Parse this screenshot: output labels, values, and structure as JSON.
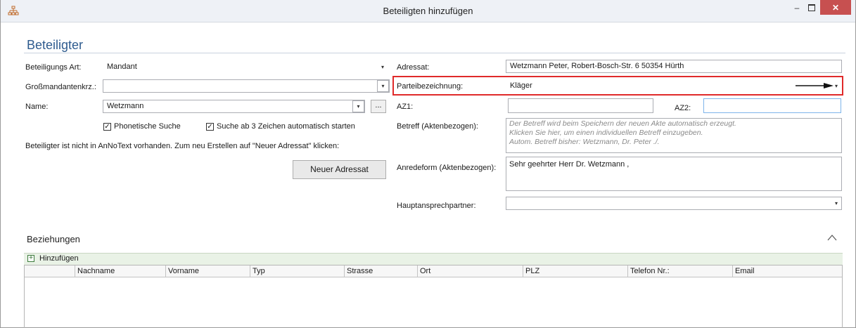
{
  "window": {
    "title": "Beteiligten hinzufügen",
    "app_icon": "network-icon",
    "minimize_glyph": "–",
    "close_glyph": "✕"
  },
  "section": {
    "heading": "Beteiligter"
  },
  "left": {
    "beteiligungs_art": {
      "label": "Beteiligungs Art:",
      "value": "Mandant"
    },
    "grossmandant": {
      "label": "Großmandantenkrz.:",
      "value": ""
    },
    "name": {
      "label": "Name:",
      "value": "Wetzmann",
      "button": "..."
    },
    "phonetisch": {
      "label": "Phonetische Suche",
      "checked": true
    },
    "auto_suche": {
      "label": "Suche ab 3 Zeichen automatisch starten",
      "checked": true
    },
    "info": "Beteiligter ist nicht in AnNoText vorhanden. Zum neu Erstellen auf \"Neuer Adressat\" klicken:",
    "neuer_adressat": "Neuer Adressat"
  },
  "right": {
    "adressat": {
      "label": "Adressat:",
      "value": "Wetzmann Peter, Robert-Bosch-Str. 6 50354 Hürth"
    },
    "parteibezeichnung": {
      "label": "Parteibezeichnung:",
      "value": "Kläger"
    },
    "az1": {
      "label": "AZ1:",
      "value": ""
    },
    "az2": {
      "label": "AZ2:",
      "value": ""
    },
    "betreff": {
      "label": "Betreff (Aktenbezogen):",
      "hint1": "Der Betreff wird beim Speichern der neuen Akte automatisch erzeugt.",
      "hint2": "Klicken Sie hier, um einen individuellen Betreff einzugeben.",
      "hint3": "Autom. Betreff bisher: Wetzmann, Dr. Peter ./."
    },
    "anredeform": {
      "label": "Anredeform (Aktenbezogen):",
      "value": "Sehr geehrter Herr Dr. Wetzmann ,"
    },
    "hauptansprechpartner": {
      "label": "Hauptansprechpartner:",
      "value": ""
    }
  },
  "beziehungen": {
    "title": "Beziehungen",
    "add_label": "Hinzufügen",
    "columns": [
      "Nachname",
      "Vorname",
      "Typ",
      "Strasse",
      "Ort",
      "PLZ",
      "Telefon Nr.:",
      "Email"
    ]
  },
  "glyphs": {
    "dropdown": "▾",
    "checkmark": "✓",
    "plus": "+"
  },
  "colors": {
    "accent": "#2f5c8f",
    "highlight": "#e02a2a",
    "close": "#c75050"
  }
}
